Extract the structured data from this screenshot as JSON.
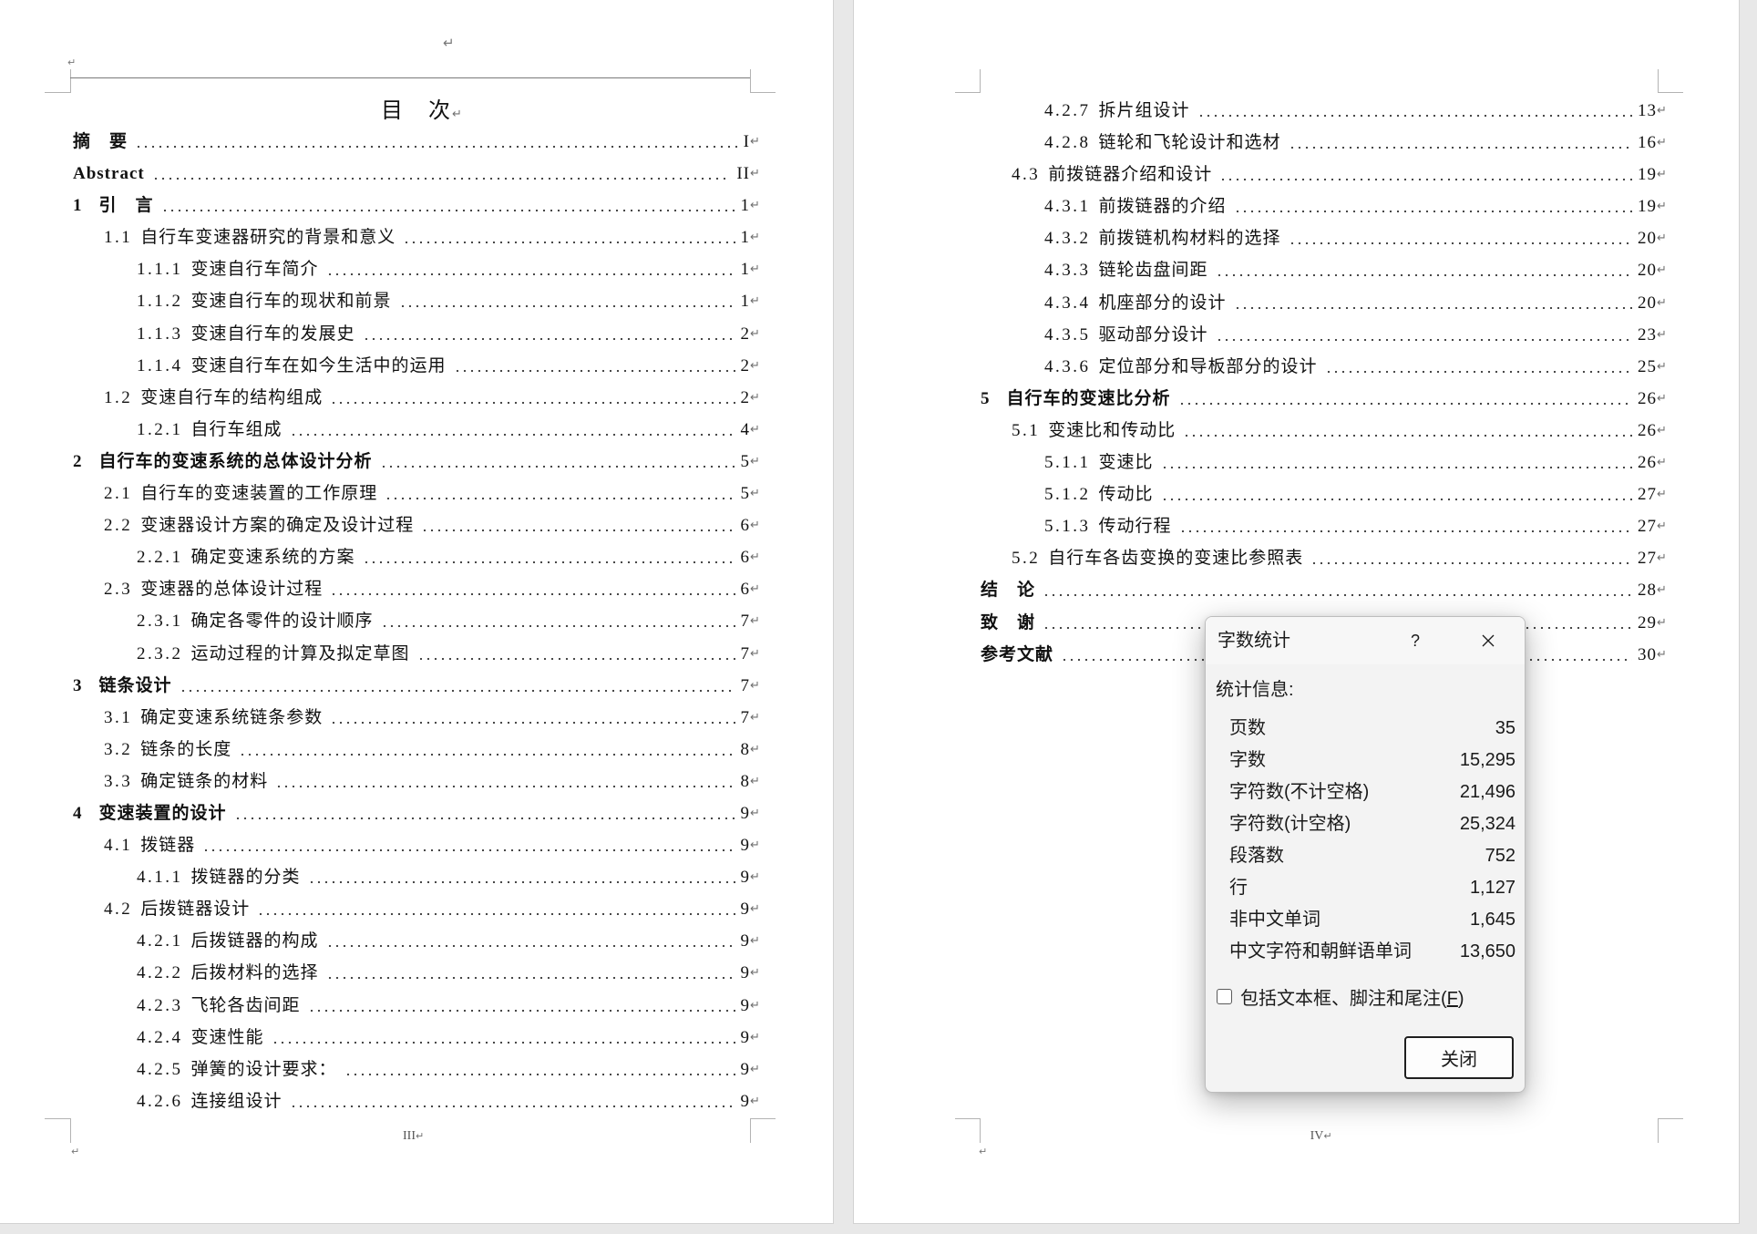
{
  "paragraph_mark": "↵",
  "left_page": {
    "title": "目　次",
    "footer": "III",
    "toc": [
      {
        "num": "",
        "title": "摘　要",
        "page": "I"
      },
      {
        "num": "",
        "title": "Abstract",
        "page": "II"
      },
      {
        "num": "1",
        "title": "引　言",
        "page": "1"
      },
      {
        "num": "1.1",
        "title": "自行车变速器研究的背景和意义",
        "page": "1"
      },
      {
        "num": "1.1.1",
        "title": "变速自行车简介",
        "page": "1"
      },
      {
        "num": "1.1.2",
        "title": "变速自行车的现状和前景",
        "page": "1"
      },
      {
        "num": "1.1.3",
        "title": "变速自行车的发展史",
        "page": "2"
      },
      {
        "num": "1.1.4",
        "title": "变速自行车在如今生活中的运用",
        "page": "2"
      },
      {
        "num": "1.2",
        "title": "变速自行车的结构组成",
        "page": "2"
      },
      {
        "num": "1.2.1",
        "title": "自行车组成",
        "page": "4"
      },
      {
        "num": "2",
        "title": "自行车的变速系统的总体设计分析",
        "page": "5"
      },
      {
        "num": "2.1",
        "title": "自行车的变速装置的工作原理",
        "page": "5"
      },
      {
        "num": "2.2",
        "title": "变速器设计方案的确定及设计过程",
        "page": "6"
      },
      {
        "num": "2.2.1",
        "title": "确定变速系统的方案",
        "page": "6"
      },
      {
        "num": "2.3",
        "title": "变速器的总体设计过程",
        "page": "6"
      },
      {
        "num": "2.3.1",
        "title": "确定各零件的设计顺序",
        "page": "7"
      },
      {
        "num": "2.3.2",
        "title": "运动过程的计算及拟定草图",
        "page": "7"
      },
      {
        "num": "3",
        "title": "链条设计",
        "page": "7"
      },
      {
        "num": "3.1",
        "title": "确定变速系统链条参数",
        "page": "7"
      },
      {
        "num": "3.2",
        "title": "链条的长度",
        "page": "8"
      },
      {
        "num": "3.3",
        "title": "确定链条的材料",
        "page": "8"
      },
      {
        "num": "4",
        "title": "变速装置的设计",
        "page": "9"
      },
      {
        "num": "4.1",
        "title": "拨链器",
        "page": "9"
      },
      {
        "num": "4.1.1",
        "title": "拨链器的分类",
        "page": "9"
      },
      {
        "num": "4.2",
        "title": "后拨链器设计",
        "page": "9"
      },
      {
        "num": "4.2.1",
        "title": "后拨链器的构成",
        "page": "9"
      },
      {
        "num": "4.2.2",
        "title": "后拨材料的选择",
        "page": "9"
      },
      {
        "num": "4.2.3",
        "title": "飞轮各齿间距",
        "page": "9"
      },
      {
        "num": "4.2.4",
        "title": "变速性能",
        "page": "9"
      },
      {
        "num": "4.2.5",
        "title": "弹簧的设计要求：",
        "page": "9"
      },
      {
        "num": "4.2.6",
        "title": "连接组设计",
        "page": "9"
      }
    ]
  },
  "right_page": {
    "footer": "IV",
    "toc": [
      {
        "num": "4.2.7",
        "title": "拆片组设计",
        "page": "13"
      },
      {
        "num": "4.2.8",
        "title": "链轮和飞轮设计和选材",
        "page": "16"
      },
      {
        "num": "4.3",
        "title": "前拨链器介绍和设计",
        "page": "19"
      },
      {
        "num": "4.3.1",
        "title": "前拨链器的介绍",
        "page": "19"
      },
      {
        "num": "4.3.2",
        "title": "前拨链机构材料的选择",
        "page": "20"
      },
      {
        "num": "4.3.3",
        "title": "链轮齿盘间距",
        "page": "20"
      },
      {
        "num": "4.3.4",
        "title": "机座部分的设计",
        "page": "20"
      },
      {
        "num": "4.3.5",
        "title": "驱动部分设计",
        "page": "23"
      },
      {
        "num": "4.3.6",
        "title": "定位部分和导板部分的设计",
        "page": "25"
      },
      {
        "num": "5",
        "title": "自行车的变速比分析",
        "page": "26"
      },
      {
        "num": "5.1",
        "title": "变速比和传动比",
        "page": "26"
      },
      {
        "num": "5.1.1",
        "title": "变速比",
        "page": "26"
      },
      {
        "num": "5.1.2",
        "title": "传动比",
        "page": "27"
      },
      {
        "num": "5.1.3",
        "title": "传动行程",
        "page": "27"
      },
      {
        "num": "5.2",
        "title": "自行车各齿变换的变速比参照表",
        "page": "27"
      },
      {
        "num": "",
        "title": "结　论",
        "page": "28"
      },
      {
        "num": "",
        "title": "致　谢",
        "page": "29"
      },
      {
        "num": "",
        "title": "参考文献",
        "page": "30"
      }
    ]
  },
  "dialog": {
    "title": "字数统计",
    "help_glyph": "?",
    "close_icon": "close-icon",
    "section_label": "统计信息:",
    "stats": [
      {
        "label": "页数",
        "value": "35"
      },
      {
        "label": "字数",
        "value": "15,295"
      },
      {
        "label": "字符数(不计空格)",
        "value": "21,496"
      },
      {
        "label": "字符数(计空格)",
        "value": "25,324"
      },
      {
        "label": "段落数",
        "value": "752"
      },
      {
        "label": "行",
        "value": "1,127"
      },
      {
        "label": "非中文单词",
        "value": "1,645"
      },
      {
        "label": "中文字符和朝鲜语单词",
        "value": "13,650"
      }
    ],
    "checkbox": {
      "label_before": "包括文本框、脚注和尾注(",
      "access_key": "F",
      "label_after": ")",
      "checked": false
    },
    "close_button": "关闭"
  }
}
